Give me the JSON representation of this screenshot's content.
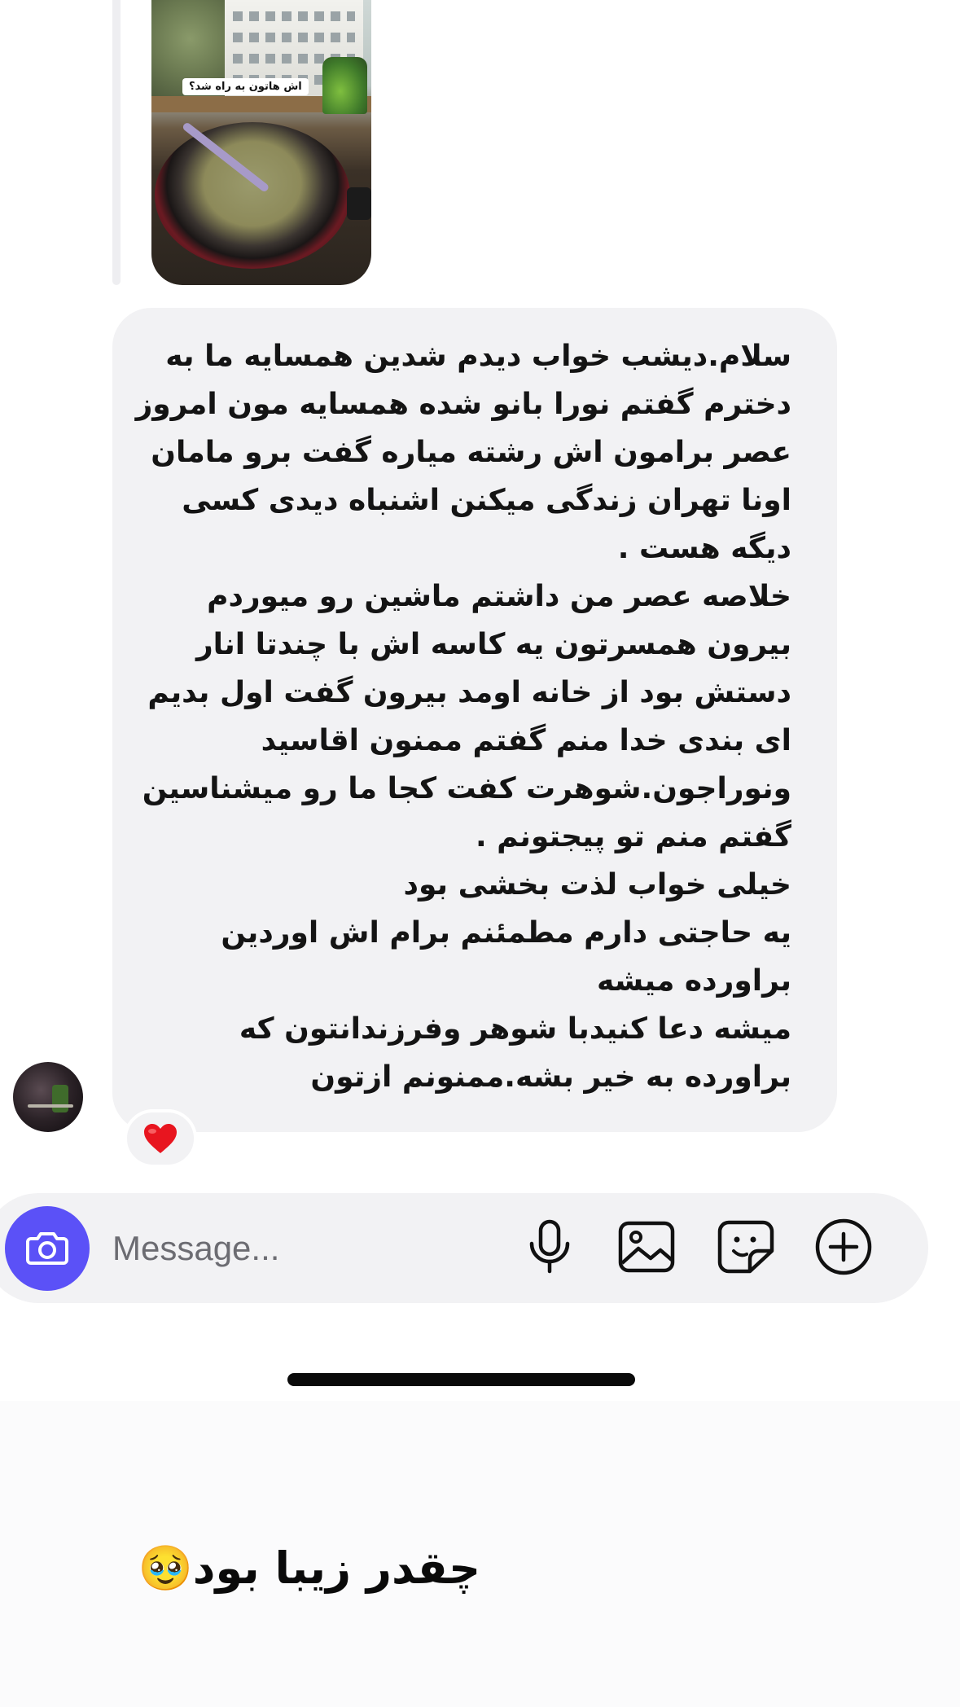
{
  "story_reply": {
    "image_caption": "اش هاتون به راه شد؟"
  },
  "message": {
    "text": "سلام.دیشب خواب دیدم شدین همسایه ما به دخترم گفتم نورا بانو شده همسایه مون امروز عصر برامون اش رشته میاره گفت برو مامان اونا تهران زندگی میکنن اشنباه دیدی کسی دیگه هست .\nخلاصه عصر من داشتم ماشین رو میوردم بیرون همسرتون یه کاسه اش با چندتا انار دستش بود از خانه اومد بیرون گفت اول بدیم ای بندی خدا منم گفتم ممنون اقاسید ونوراجون.شوهرت کفت کجا ما رو میشناسین گفتم منم تو پیجتونم .\nخیلی خواب لذت بخشی بود\nیه حاجتی دارم مطمئنم برام اش اوردین براورده میشه\nمیشه دعا کنیدبا شوهر وفرزندانتون که براورده به خیر بشه.ممنونم ازتون",
    "reaction": "❤️"
  },
  "composer": {
    "placeholder": "Message...",
    "accent_color": "#5b51f7",
    "icons": [
      "camera-icon",
      "microphone-icon",
      "gallery-icon",
      "sticker-icon",
      "plus-icon"
    ]
  },
  "overlay_caption": "چقدر زیبا بود🥹"
}
